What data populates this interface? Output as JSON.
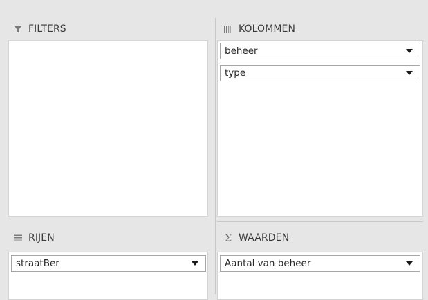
{
  "filters": {
    "header": "FILTERS",
    "icon": "funnel-icon",
    "fields": []
  },
  "columns": {
    "header": "KOLOMMEN",
    "icon": "columns-icon",
    "fields": [
      {
        "label": "beheer"
      },
      {
        "label": "type"
      }
    ]
  },
  "rows": {
    "header": "RIJEN",
    "icon": "rows-icon",
    "fields": [
      {
        "label": "straatBer"
      }
    ]
  },
  "values": {
    "header": "WAARDEN",
    "icon": "sigma-icon",
    "icon_glyph": "Σ",
    "fields": [
      {
        "label": "Aantal van beheer"
      }
    ]
  },
  "colors": {
    "background": "#e6e6e6",
    "drop_area": "#ffffff",
    "field_border": "#a6a6a6",
    "divider": "#c8c8c8"
  }
}
